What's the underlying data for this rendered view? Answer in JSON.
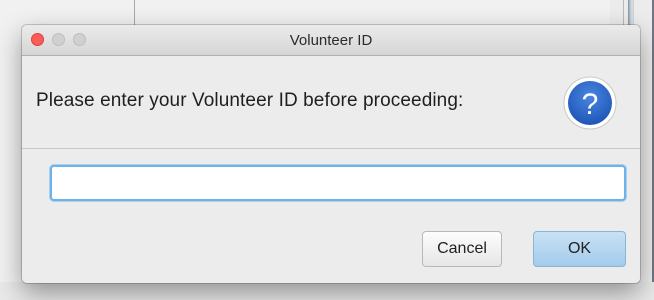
{
  "dialog": {
    "title": "Volunteer ID",
    "message": "Please enter your Volunteer ID before proceeding:",
    "icon": "question-mark-icon",
    "input": {
      "value": "",
      "placeholder": ""
    },
    "cancel_label": "Cancel",
    "ok_label": "OK",
    "help_icon_glyph": "?"
  },
  "colors": {
    "accent": "#6fb2e8",
    "close_light": "#fc5b57",
    "ok_button": "#a3cceb",
    "help_icon": "#2f68c7"
  }
}
